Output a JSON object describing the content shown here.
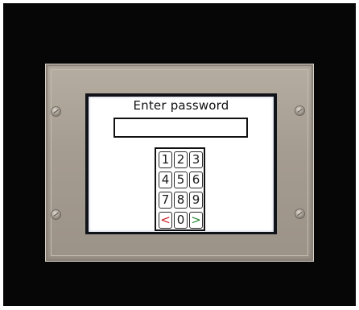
{
  "screen": {
    "prompt": "Enter password",
    "password_value": "",
    "keypad": {
      "keys": [
        {
          "label": "1",
          "kind": "digit"
        },
        {
          "label": "2",
          "kind": "digit"
        },
        {
          "label": "3",
          "kind": "digit"
        },
        {
          "label": "4",
          "kind": "digit"
        },
        {
          "label": "5",
          "kind": "digit"
        },
        {
          "label": "6",
          "kind": "digit"
        },
        {
          "label": "7",
          "kind": "digit"
        },
        {
          "label": "8",
          "kind": "digit"
        },
        {
          "label": "9",
          "kind": "digit"
        },
        {
          "label": "<",
          "kind": "backspace",
          "color": "#c8222a"
        },
        {
          "label": "0",
          "kind": "digit"
        },
        {
          "label": ">",
          "kind": "enter",
          "color": "#2f8a3a"
        }
      ]
    }
  },
  "colors": {
    "bezel": "#a59c91",
    "backdrop": "#060607",
    "screen": "#ffffff"
  }
}
